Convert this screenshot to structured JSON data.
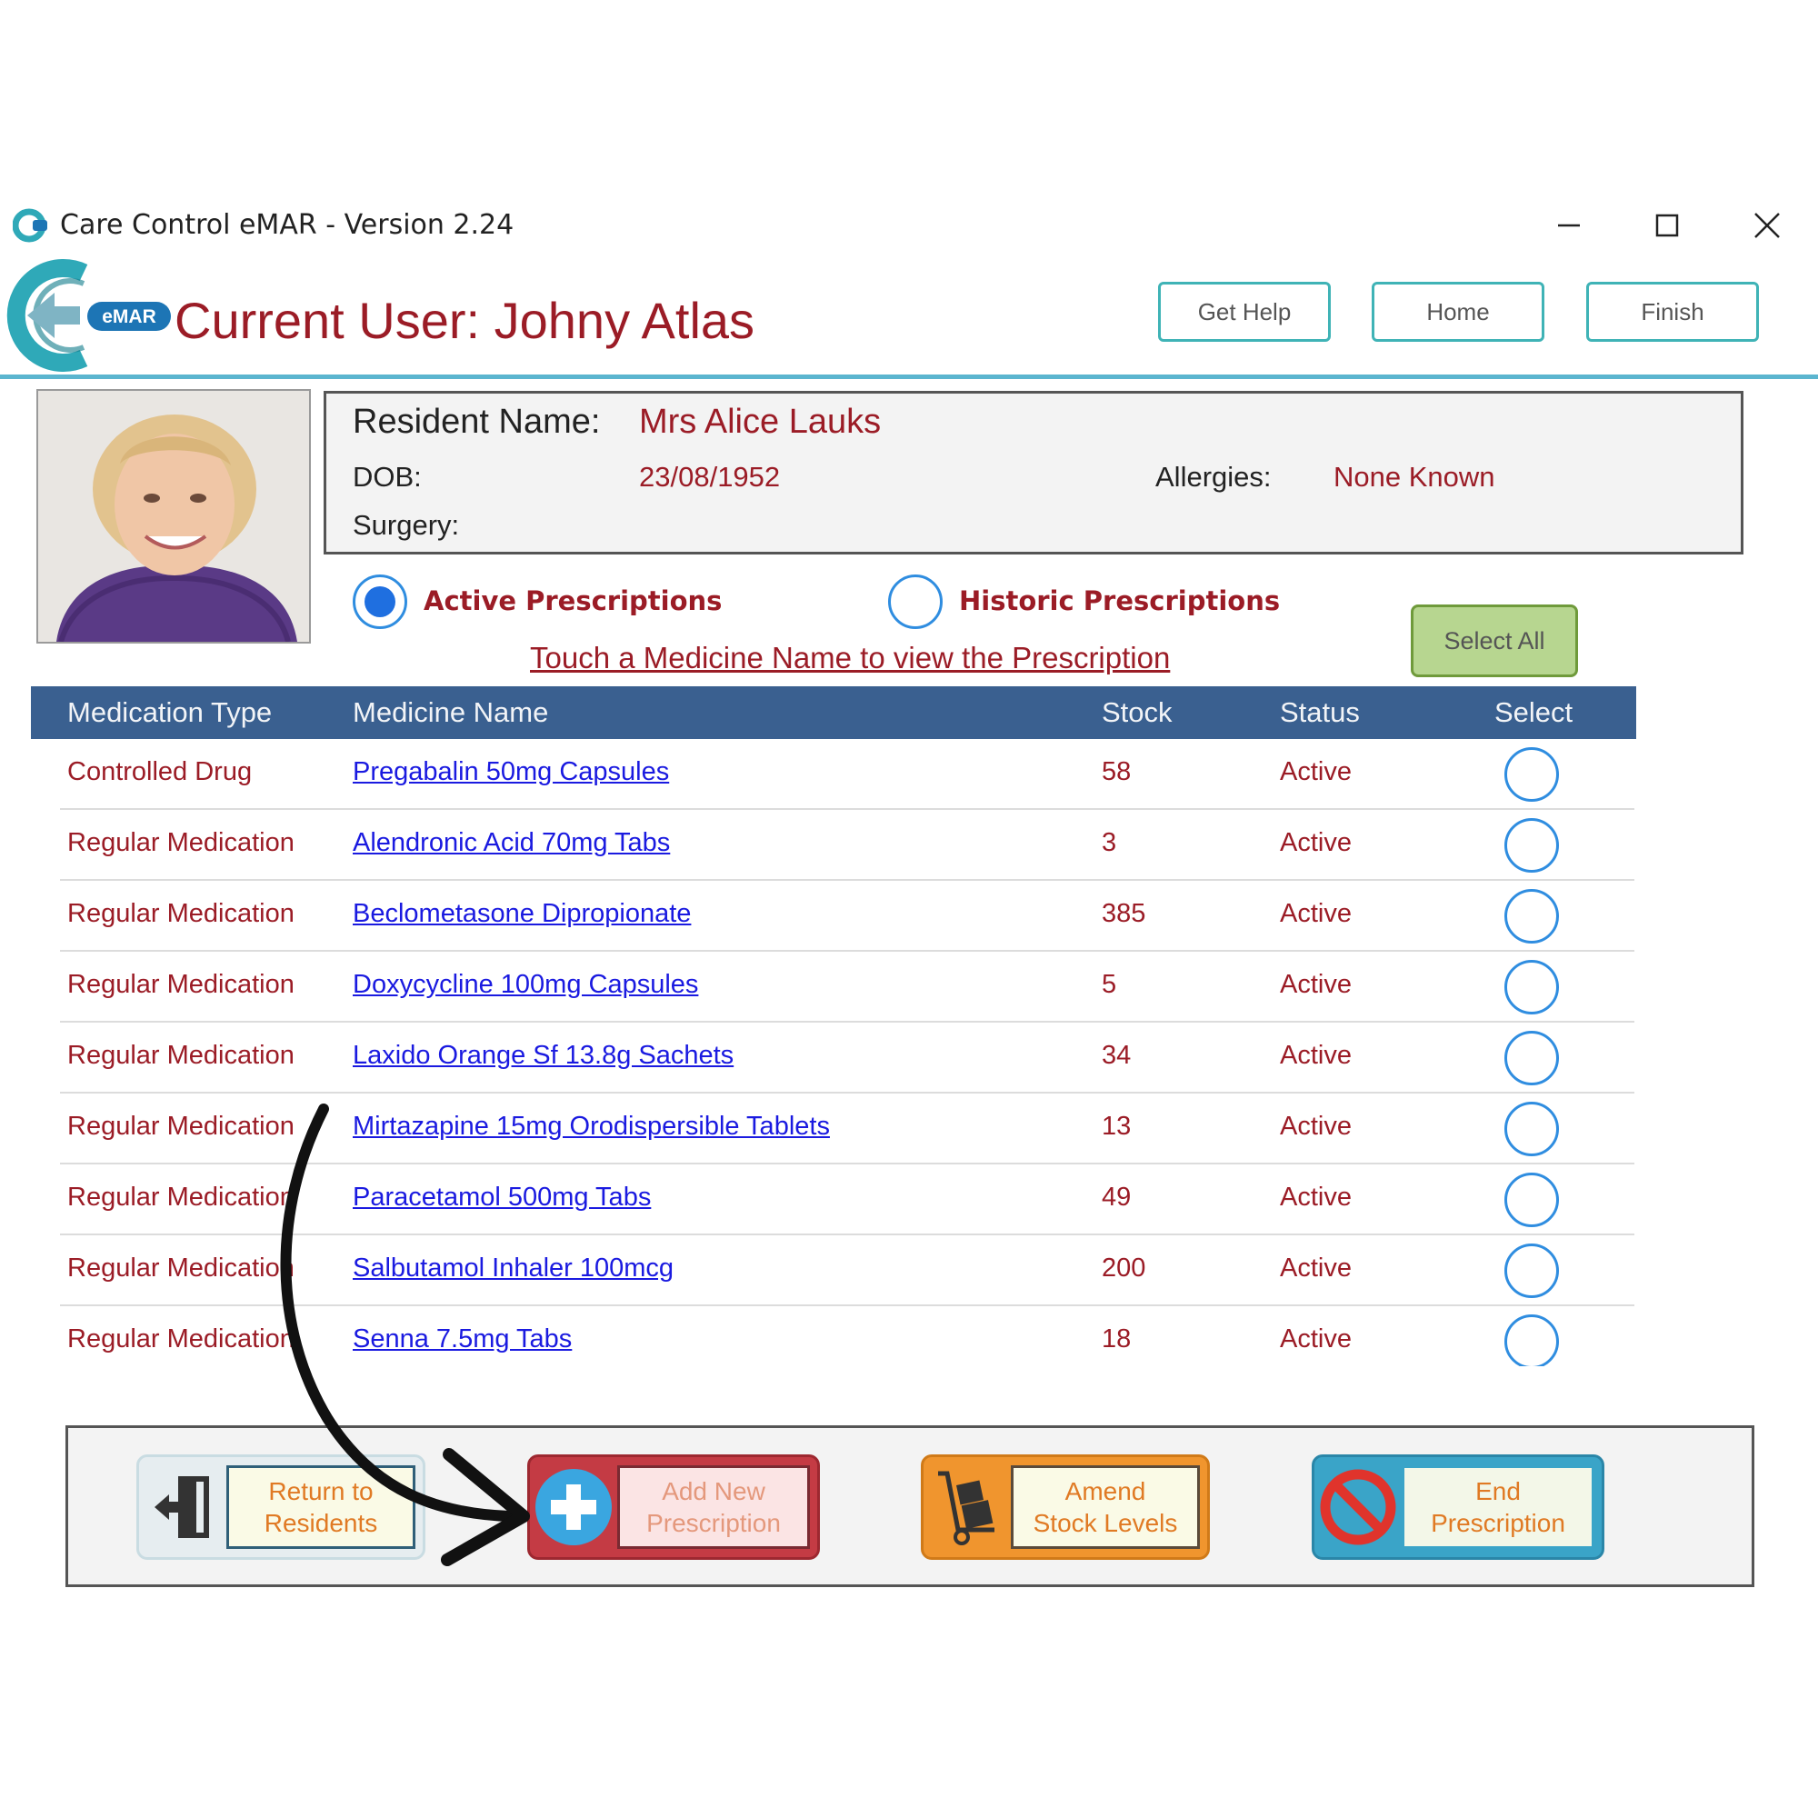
{
  "window": {
    "title": "Care Control eMAR - Version 2.24",
    "controls": [
      "minimize",
      "maximize",
      "close"
    ]
  },
  "header": {
    "logo_badge": "eMAR",
    "current_user": "Current User: Johny Atlas",
    "buttons": {
      "help": "Get Help",
      "home": "Home",
      "finish": "Finish"
    }
  },
  "resident": {
    "name_label": "Resident Name:",
    "name": "Mrs Alice Lauks",
    "dob_label": "DOB:",
    "dob": "23/08/1952",
    "allergies_label": "Allergies:",
    "allergies": "None Known",
    "surgery_label": "Surgery:",
    "surgery": ""
  },
  "filters": {
    "active": {
      "label": "Active Prescriptions",
      "selected": true
    },
    "historic": {
      "label": "Historic Prescriptions",
      "selected": false
    }
  },
  "hint": "Touch a Medicine Name to view the Prescription",
  "select_all_label": "Select All",
  "table": {
    "columns": [
      "Medication Type",
      "Medicine Name",
      "Stock",
      "Status",
      "Select"
    ],
    "rows": [
      {
        "type": "Controlled Drug",
        "name": "Pregabalin 50mg Capsules",
        "stock": "58",
        "status": "Active"
      },
      {
        "type": "Regular Medication",
        "name": "Alendronic Acid 70mg Tabs",
        "stock": "3",
        "status": "Active"
      },
      {
        "type": "Regular Medication",
        "name": "Beclometasone Dipropionate",
        "stock": "385",
        "status": "Active"
      },
      {
        "type": "Regular Medication",
        "name": "Doxycycline 100mg Capsules",
        "stock": "5",
        "status": "Active"
      },
      {
        "type": "Regular Medication",
        "name": "Laxido Orange Sf 13.8g Sachets",
        "stock": "34",
        "status": "Active"
      },
      {
        "type": "Regular Medication",
        "name": "Mirtazapine 15mg Orodispersible Tablets",
        "stock": "13",
        "status": "Active"
      },
      {
        "type": "Regular Medication",
        "name": "Paracetamol 500mg Tabs",
        "stock": "49",
        "status": "Active"
      },
      {
        "type": "Regular Medication",
        "name": "Salbutamol Inhaler 100mcg",
        "stock": "200",
        "status": "Active"
      },
      {
        "type": "Regular Medication",
        "name": "Senna 7.5mg Tabs",
        "stock": "18",
        "status": "Active"
      }
    ]
  },
  "actions": {
    "return": {
      "line1": "Return to",
      "line2": "Residents",
      "icon": "exit-door-icon"
    },
    "add": {
      "line1": "Add New",
      "line2": "Prescription",
      "icon": "plus-circle-icon"
    },
    "amend": {
      "line1": "Amend",
      "line2": "Stock Levels",
      "icon": "hand-truck-icon"
    },
    "end": {
      "line1": "End",
      "line2": "Prescription",
      "icon": "no-entry-icon"
    }
  },
  "colors": {
    "brand_red": "#9b1c26",
    "header_teal": "#3fb3b6",
    "table_header": "#3a6090",
    "link_blue": "#1a1ae0",
    "radio_blue": "#2f8de0"
  }
}
